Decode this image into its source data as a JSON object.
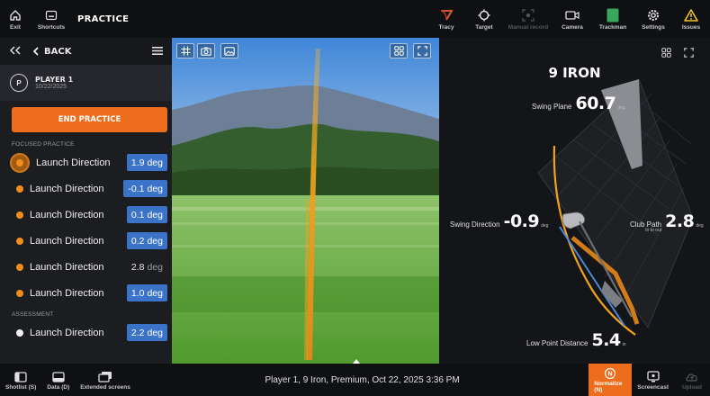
{
  "topbar": {
    "exit_label": "Exit",
    "shortcuts_label": "Shortcuts",
    "title": "PRACTICE",
    "tools": [
      {
        "label": "Tracy",
        "icon": "tracy-icon",
        "state": "enabled"
      },
      {
        "label": "Target",
        "icon": "target-icon",
        "state": "enabled"
      },
      {
        "label": "Manual record",
        "icon": "manual-record-icon",
        "state": "disabled"
      },
      {
        "label": "Camera",
        "icon": "camera-icon",
        "state": "enabled"
      },
      {
        "label": "Trackman",
        "icon": "trackman-icon",
        "state": "enabled"
      },
      {
        "label": "Settings",
        "icon": "gear-icon",
        "state": "enabled"
      },
      {
        "label": "Issues",
        "icon": "warning-icon",
        "state": "enabled"
      }
    ]
  },
  "sidebar": {
    "back_label": "BACK",
    "player": {
      "initial": "P",
      "name": "PLAYER 1",
      "date": "10/22/2025"
    },
    "end_button": "END PRACTICE",
    "focused_section": "FOCUSED PRACTICE",
    "focused_items": [
      {
        "label": "Launch Direction",
        "value": "1.9",
        "unit": "deg",
        "style": "blue",
        "selected": true
      },
      {
        "label": "Launch Direction",
        "value": "-0.1",
        "unit": "deg",
        "style": "blue",
        "selected": false
      },
      {
        "label": "Launch Direction",
        "value": "0.1",
        "unit": "deg",
        "style": "blue",
        "selected": false
      },
      {
        "label": "Launch Direction",
        "value": "0.2",
        "unit": "deg",
        "style": "blue",
        "selected": false
      },
      {
        "label": "Launch Direction",
        "value": "2.8",
        "unit": "deg",
        "style": "plain",
        "selected": false
      },
      {
        "label": "Launch Direction",
        "value": "1.0",
        "unit": "deg",
        "style": "blue",
        "selected": false
      }
    ],
    "assessment_section": "ASSESSMENT",
    "assessment_items": [
      {
        "label": "Launch Direction",
        "value": "2.2",
        "unit": "deg",
        "style": "blue"
      }
    ]
  },
  "analysis": {
    "club": "9 IRON",
    "swing_plane": {
      "label": "Swing Plane",
      "value": "60.7",
      "unit": "deg"
    },
    "swing_direction": {
      "label": "Swing Direction",
      "value": "-0.9",
      "unit": "deg"
    },
    "club_path": {
      "label": "Club Path",
      "sub": "In to out",
      "value": "2.8",
      "unit": "deg"
    },
    "low_point": {
      "label": "Low Point Distance",
      "value": "5.4",
      "unit": "in"
    }
  },
  "bottombar": {
    "shotlist_label": "Shotlist (S)",
    "data_label": "Data (D)",
    "extended_label": "Extended screens",
    "status": "Player 1, 9 Iron, Premium, Oct 22, 2025 3:36 PM",
    "normalize_label": "Normalize (N)",
    "screencast_label": "Screencast",
    "upload_label": "Upload"
  },
  "colors": {
    "accent": "#ee6d1c",
    "value_blue": "#3b73c9",
    "tracer": "#f2a31e",
    "topbar_bg": "#0f1012"
  }
}
